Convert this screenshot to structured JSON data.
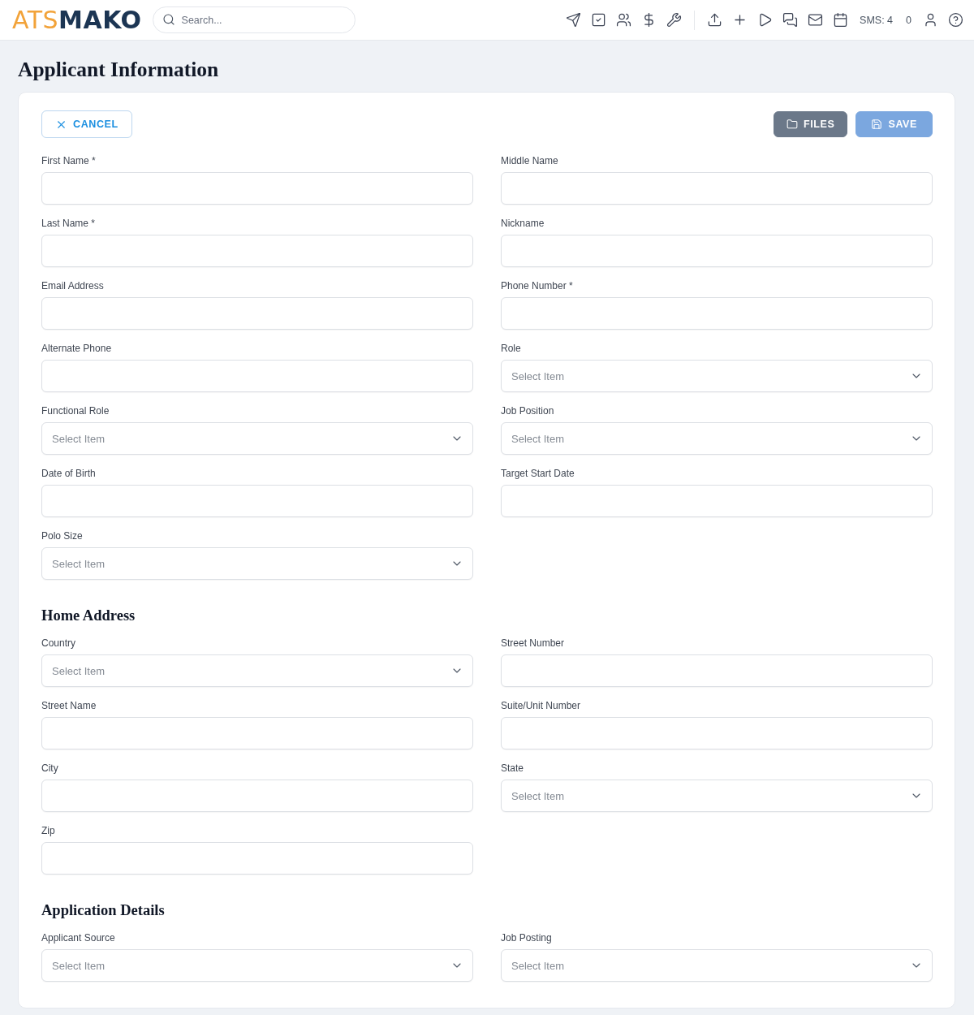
{
  "header": {
    "logo": {
      "prefix": "ATS",
      "name": "MAKO"
    },
    "search": {
      "placeholder": "Search..."
    },
    "sms": "SMS: 4",
    "counter": "0"
  },
  "page_title": "Applicant Information",
  "actions": {
    "cancel": {
      "label": "CANCEL"
    },
    "files": {
      "label": "FILES"
    },
    "save": {
      "label": "SAVE",
      "disabled": true
    }
  },
  "sections": [
    {
      "fields": [
        {
          "kind": "text",
          "label": "First Name *"
        },
        {
          "kind": "text",
          "label": "Middle Name"
        },
        {
          "kind": "text",
          "label": "Last Name *"
        },
        {
          "kind": "text",
          "label": "Nickname"
        },
        {
          "kind": "text",
          "label": "Email Address"
        },
        {
          "kind": "text",
          "label": "Phone Number *"
        },
        {
          "kind": "text",
          "label": "Alternate Phone"
        },
        {
          "kind": "select",
          "label": "Role",
          "placeholder": "Select Item"
        },
        {
          "kind": "select",
          "label": "Functional Role",
          "placeholder": "Select Item"
        },
        {
          "kind": "select",
          "label": "Job Position",
          "placeholder": "Select Item"
        },
        {
          "kind": "text",
          "label": "Date of Birth"
        },
        {
          "kind": "text",
          "label": "Target Start Date"
        },
        {
          "kind": "select",
          "label": "Polo Size",
          "placeholder": "Select Item"
        }
      ]
    },
    {
      "title": "Home Address",
      "fields": [
        {
          "kind": "select",
          "label": "Country",
          "placeholder": "Select Item"
        },
        {
          "kind": "text",
          "label": "Street Number"
        },
        {
          "kind": "text",
          "label": "Street Name"
        },
        {
          "kind": "text",
          "label": "Suite/Unit Number"
        },
        {
          "kind": "text",
          "label": "City"
        },
        {
          "kind": "select",
          "label": "State",
          "placeholder": "Select Item"
        },
        {
          "kind": "text",
          "label": "Zip"
        }
      ]
    },
    {
      "title": "Application Details",
      "fields": [
        {
          "kind": "select",
          "label": "Applicant Source",
          "placeholder": "Select Item"
        },
        {
          "kind": "select",
          "label": "Job Posting",
          "placeholder": "Select Item"
        }
      ]
    }
  ]
}
